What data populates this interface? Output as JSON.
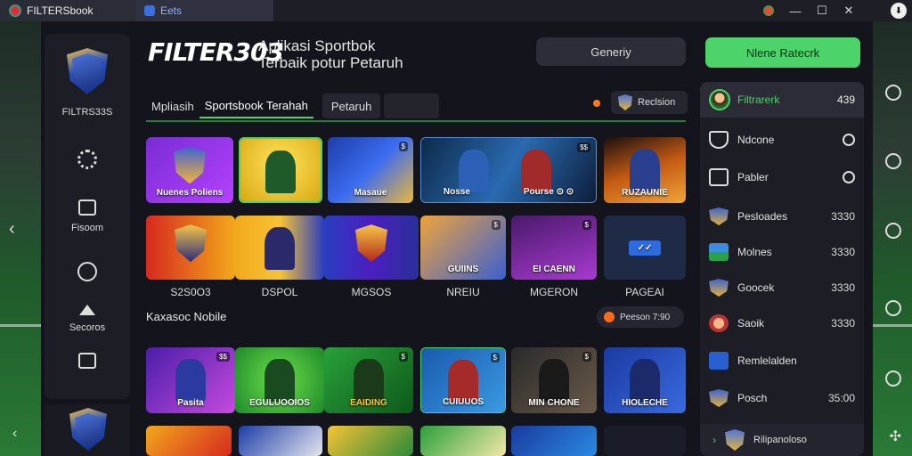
{
  "titlebar": {
    "tab1": "FILTERSbook",
    "tab2": "Eets",
    "controls": {
      "minimize": "—",
      "maximize": "☐",
      "close": "✕",
      "download": "⬇"
    }
  },
  "side": {
    "logo_label": "FILTRS33S",
    "items": [
      {
        "label": ""
      },
      {
        "label": "Fisoom"
      },
      {
        "label": ""
      },
      {
        "label": "Secoros"
      },
      {
        "label": ""
      }
    ]
  },
  "header": {
    "brand": "FILTER303",
    "subtitle_line1": "Aplikasi Sportbok",
    "subtitle_line2": "Terbaik potur Petaruh",
    "btn_secondary": "Generiy",
    "btn_primary": "Nlene Ratecrk"
  },
  "tabs": {
    "items": [
      "Mpliasih",
      "Sportsbook Terahah",
      "Petaruh"
    ],
    "right_button": "Reclsion"
  },
  "row1": [
    {
      "label": "Nuenes Poliens"
    },
    {
      "label": ""
    },
    {
      "label": "Masaue"
    },
    {
      "label": "Nosse"
    },
    {
      "label": "Pourse ⊙ ⊙"
    },
    {
      "label": "RUZAUNIE"
    }
  ],
  "row2": [
    {
      "label": ""
    },
    {
      "label": ""
    },
    {
      "label": ""
    },
    {
      "label": "GUIINS"
    },
    {
      "label": "EI CAENN"
    },
    {
      "label": "✓✓"
    }
  ],
  "row2_captions": [
    "S2S0O3",
    "DSPOL",
    "MGSOS",
    "NREIU",
    "MGERON",
    "PAGEAI"
  ],
  "section": {
    "title": "Kaxasoc Nobile",
    "pill": "Peeson 7:90"
  },
  "row3": [
    {
      "label": "Pasita"
    },
    {
      "label": "EGULUOOIOS"
    },
    {
      "label": "EAIDING"
    },
    {
      "label": "CUIUUOS"
    },
    {
      "label": "MIN CHONE"
    },
    {
      "label": "HIOLECHE"
    }
  ],
  "right_panel": {
    "header_name": "Filtrarerk",
    "header_value": "439",
    "rows": [
      {
        "label": "Ndcone",
        "value": ""
      },
      {
        "label": "Pabler",
        "value": ""
      },
      {
        "label": "Pesloades",
        "value": "3330"
      },
      {
        "label": "Molnes",
        "value": "3330"
      },
      {
        "label": "Goocek",
        "value": "3330"
      },
      {
        "label": "Saoik",
        "value": "3330"
      },
      {
        "label": "Remlelalden",
        "value": ""
      },
      {
        "label": "Posch",
        "value": "35:00"
      }
    ],
    "footer": "Rilipanoloso"
  },
  "colors": {
    "accent_green": "#4cd46a",
    "panel_bg": "#1c1d25",
    "app_bg": "#14151c"
  }
}
